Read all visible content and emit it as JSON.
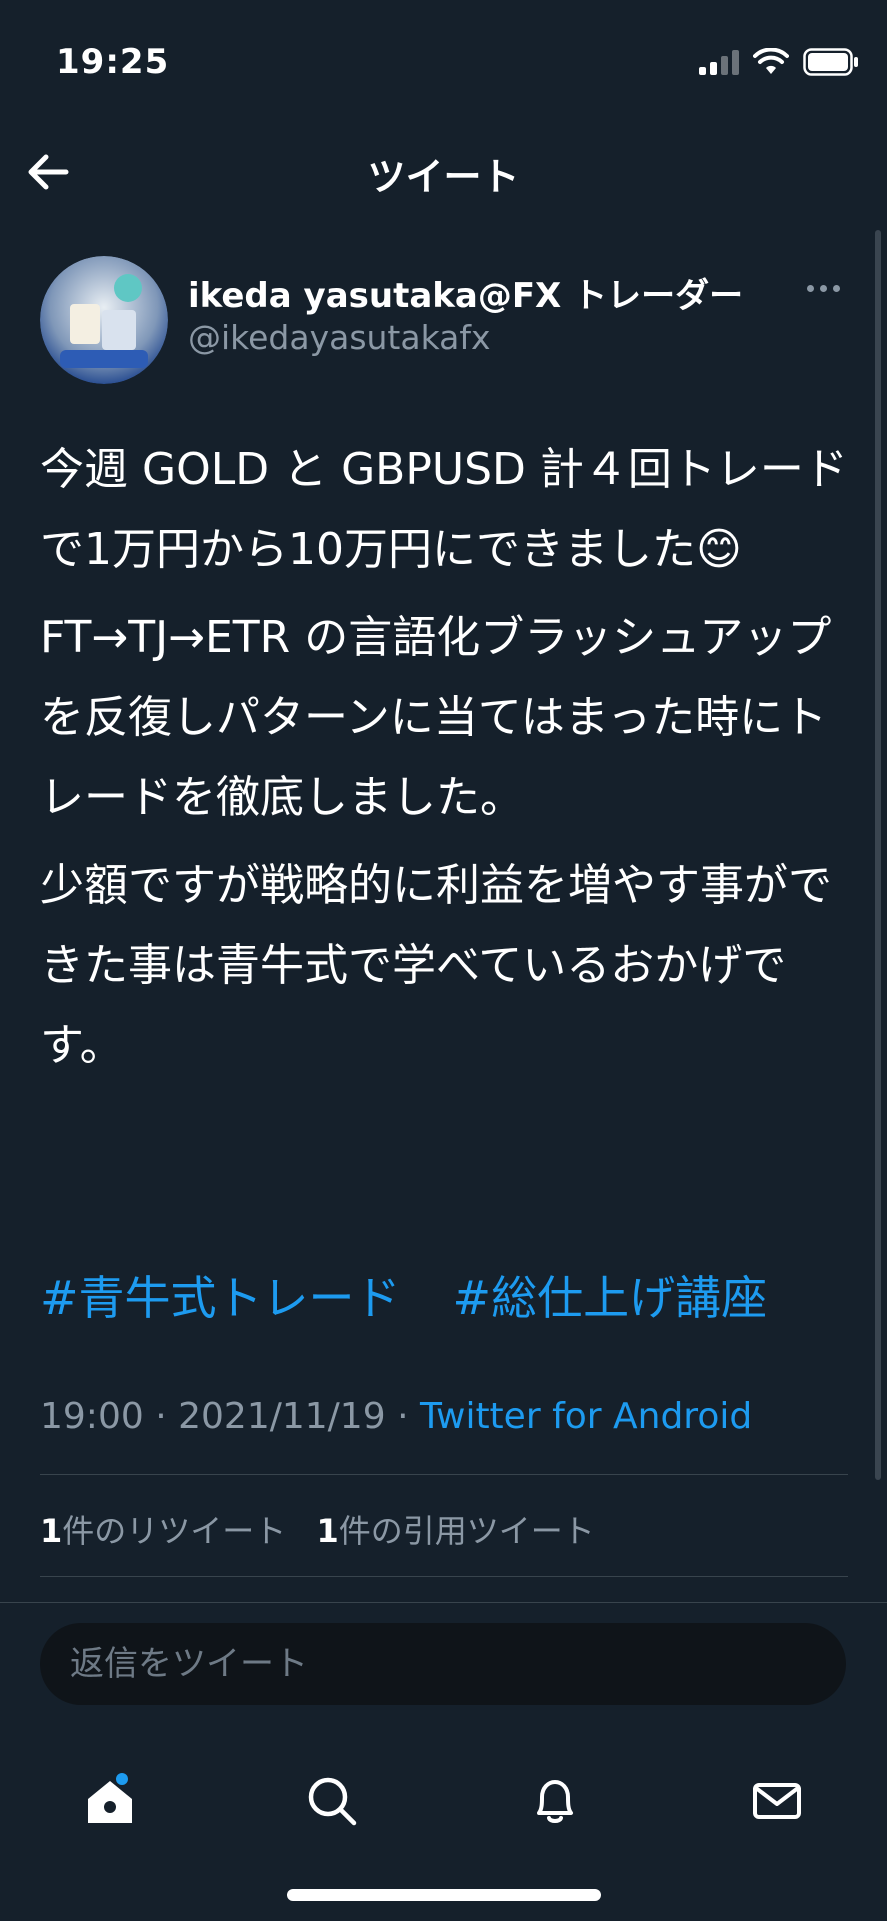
{
  "status_bar": {
    "time": "19:25"
  },
  "nav": {
    "title": "ツイート",
    "back_icon": "arrow-left-icon"
  },
  "author": {
    "name": "ikeda yasutaka@FX トレーダー",
    "handle": "@ikedayasutakafx"
  },
  "tweet": {
    "paragraphs": [
      "今週 GOLD と GBPUSD 計４回トレードで1万円から10万円にできました😊",
      "FT→TJ→ETR の言語化ブラッシュアップを反復しパターンに当てはまった時にトレードを徹底しました。",
      "少額ですが戦略的に利益を増やす事ができた事は青牛式で学べているおかげです。"
    ],
    "hashtags": [
      "#青牛式トレード",
      "#総仕上げ講座"
    ],
    "time": "19:00",
    "date": "2021/11/19",
    "separator": "·",
    "source": "Twitter for Android"
  },
  "stats": {
    "retweets_count": "1",
    "retweets_label": "件のリツイート",
    "quotes_count": "1",
    "quotes_label": "件の引用ツイート"
  },
  "reply": {
    "placeholder": "返信をツイート"
  },
  "tab_bar": {
    "tabs": [
      "home-icon",
      "search-icon",
      "bell-icon",
      "mail-icon"
    ],
    "accent": "#1d9bf0"
  },
  "colors": {
    "background": "#15202b",
    "link": "#1d9bf0",
    "muted": "#8b98a5"
  }
}
